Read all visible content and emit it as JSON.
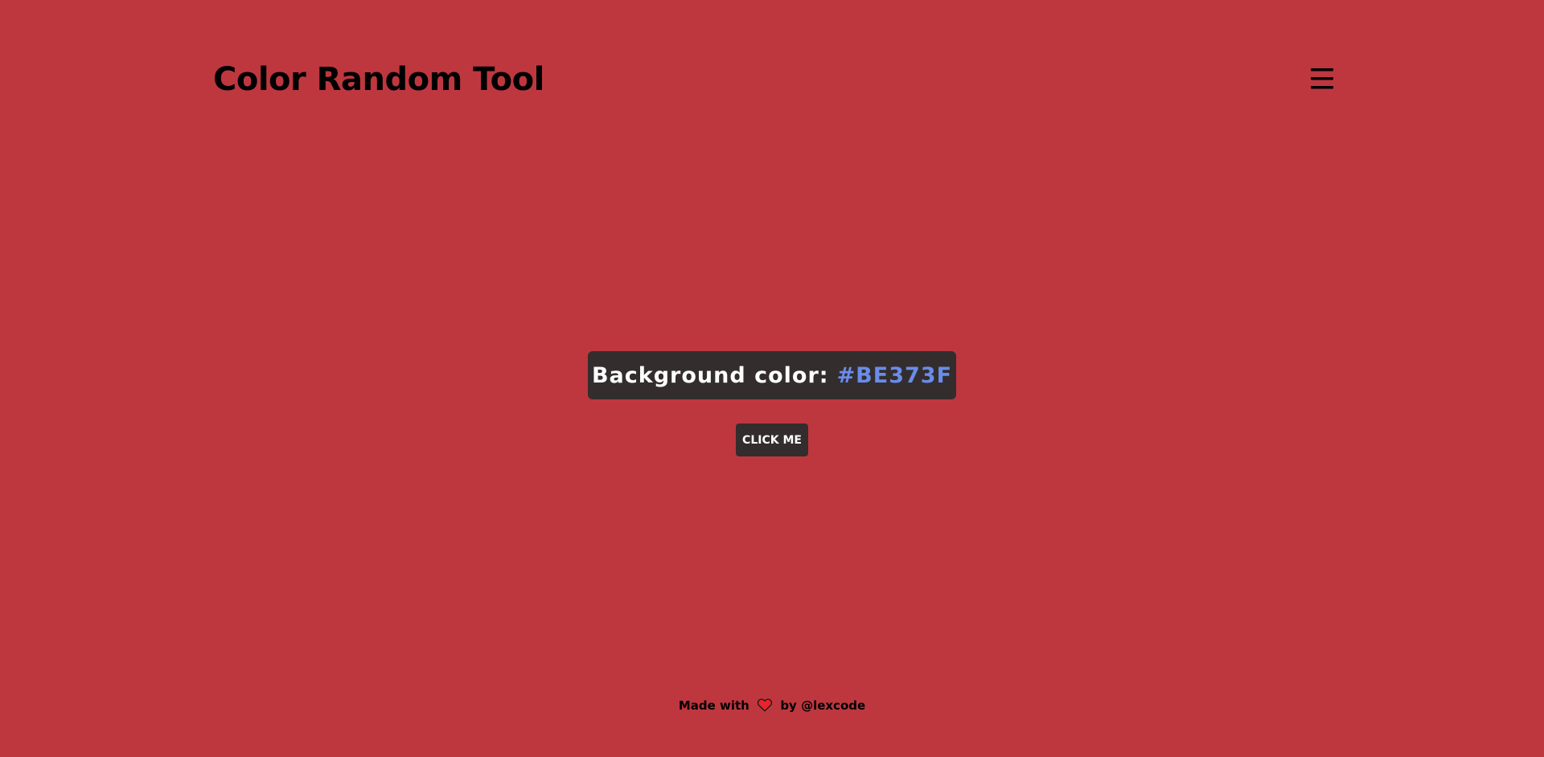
{
  "header": {
    "title": "Color Random Tool",
    "menu_icon": "hamburger-menu-icon"
  },
  "main": {
    "color_label": "Background color:",
    "color_value": "#BE373F",
    "button_label": "CLICK ME"
  },
  "footer": {
    "made_with": "Made with",
    "heart_icon": "heart-icon",
    "by": "by",
    "author": "@lexcode"
  },
  "colors": {
    "background": "#BE373F",
    "panel": "#332D2E",
    "accent": "#6A8CEA",
    "heart": "#E8232B",
    "text_dark": "#000000",
    "text_light": "#FFFFFF"
  }
}
